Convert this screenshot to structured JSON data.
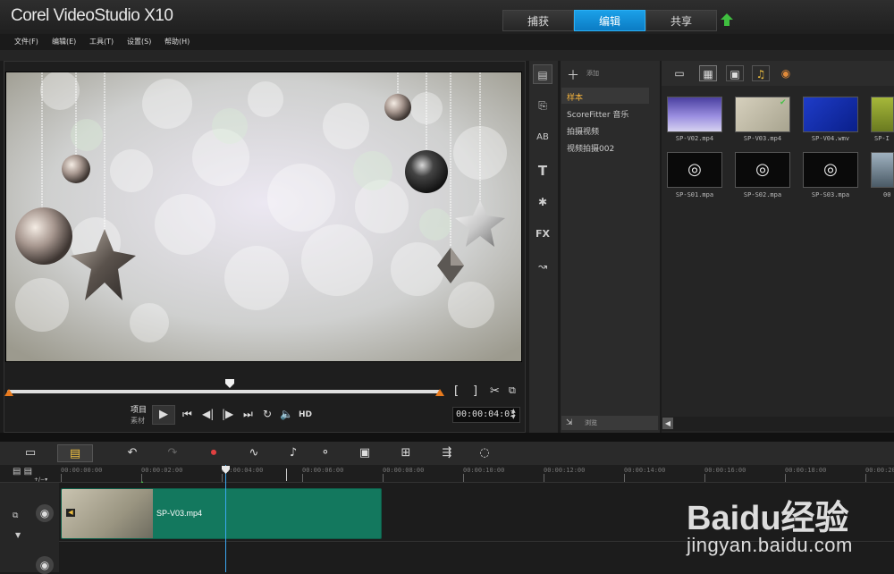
{
  "app": {
    "title": "Corel VideoStudio X10"
  },
  "main_tabs": [
    {
      "label": "捕获",
      "active": false
    },
    {
      "label": "编辑",
      "active": true
    },
    {
      "label": "共享",
      "active": false
    }
  ],
  "menu": [
    "文件(F)",
    "编辑(E)",
    "工具(T)",
    "设置(S)",
    "帮助(H)"
  ],
  "player": {
    "mode_project": "项目",
    "mode_clip": "素材",
    "hd_label": "HD",
    "timecode": "00:00:04:03",
    "mark_in": "[",
    "mark_out": "]"
  },
  "library": {
    "add_label": "添加",
    "browse_label": "浏览",
    "folders": [
      "样本",
      "ScoreFitter 音乐",
      "拍摄视频",
      "视频拍摄002"
    ],
    "selected_folder": 0,
    "media_row1": [
      "SP-V02.mp4",
      "SP-V03.mp4",
      "SP-V04.wmv",
      "SP-I"
    ],
    "media_row2": [
      "SP-S01.mpa",
      "SP-S02.mpa",
      "SP-S03.mpa",
      "00"
    ]
  },
  "timeline": {
    "ruler_ticks": [
      "00:00:00:00",
      "00:00:02:00",
      "00:00:04:00",
      "00:00:06:00",
      "00:00:08:00",
      "00:00:10:00",
      "00:00:12:00",
      "00:00:14:00",
      "00:00:16:00",
      "00:00:18:00",
      "00:00:20:00"
    ],
    "clip_name": "SP-V03.mp4"
  },
  "watermark": {
    "logo": "Baidu经验",
    "url": "jingyan.baidu.com"
  },
  "colors": {
    "accent": "#1ba0e8",
    "clip": "#13785e",
    "playhead": "#3ba7f0",
    "marker": "#e87a1d"
  }
}
